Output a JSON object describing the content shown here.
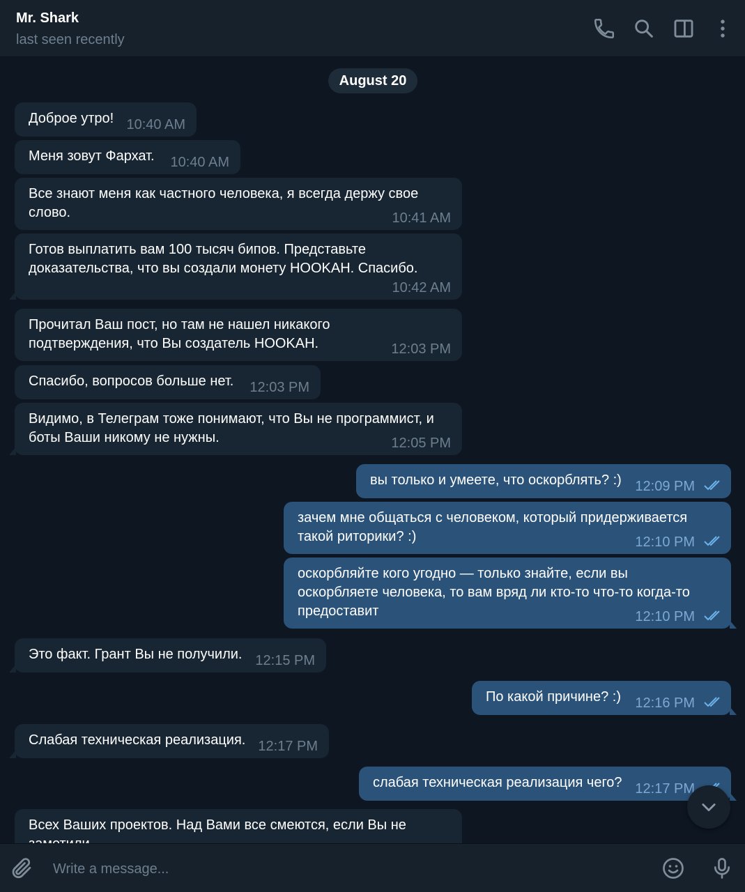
{
  "header": {
    "title": "Mr. Shark",
    "subtitle": "last seen recently",
    "icons": [
      "phone-icon",
      "search-icon",
      "sidebar-toggle-icon",
      "more-vertical-icon"
    ]
  },
  "chat": {
    "date_label": "August 20",
    "messages": [
      {
        "dir": "in",
        "text": "Доброе утро!",
        "time": "10:40 AM"
      },
      {
        "dir": "in",
        "text": "Меня зовут Фархат.",
        "time": "10:40 AM"
      },
      {
        "dir": "in",
        "text": "Все знают меня как частного человека, я всегда держу свое\nслово.",
        "time": "10:41 AM"
      },
      {
        "dir": "in",
        "text": "Готов выплатить вам 100 тысяч бипов. Представьте\nдоказательства, что вы создали монету HOOKAH. Спасибо.",
        "time": "10:42 AM"
      },
      {
        "dir": "in",
        "text": "Прочитал Ваш пост, но там не нашел никакого\nподтверждения, что Вы создатель HOOKAH.",
        "time": "12:03 PM"
      },
      {
        "dir": "in",
        "text": "Спасибо, вопросов больше нет.",
        "time": "12:03 PM"
      },
      {
        "dir": "in",
        "text": "Видимо, в Телеграм тоже понимают, что Вы не программист, и\nботы Ваши никому не нужны.",
        "time": "12:05 PM"
      },
      {
        "dir": "out",
        "text": "вы только и умеете, что оскорблять? :)",
        "time": "12:09 PM"
      },
      {
        "dir": "out",
        "text": "зачем мне общаться с человеком, который придерживается\nтакой риторики? :)",
        "time": "12:10 PM"
      },
      {
        "dir": "out",
        "text": "оскорбляйте кого угодно — только знайте, если вы\nоскорбляете человека, то вам вряд ли кто-то что-то когда-то\nпредоставит",
        "time": "12:10 PM"
      },
      {
        "dir": "in",
        "text": "Это факт. Грант Вы не получили.",
        "time": "12:15 PM"
      },
      {
        "dir": "out",
        "text": "По какой причине? :)",
        "time": "12:16 PM"
      },
      {
        "dir": "in",
        "text": "Слабая техническая реализация.",
        "time": "12:17 PM"
      },
      {
        "dir": "out",
        "text": "слабая техническая реализация чего?",
        "time": "12:17 PM"
      },
      {
        "dir": "in",
        "text": "Всех Ваших проектов. Над Вами все смеются, если Вы не\nзаметили",
        "time": ""
      }
    ]
  },
  "composer": {
    "placeholder": "Write a message...",
    "icons": [
      "attach-icon",
      "emoji-icon",
      "microphone-icon"
    ]
  },
  "colors": {
    "background": "#0e1621",
    "header": "#17212b",
    "incoming_bubble": "#182533",
    "outgoing_bubble": "#2b5278",
    "muted_text": "#6d7f8f",
    "outgoing_time": "#7da8d3",
    "read_checks": "#6cb2eb"
  }
}
